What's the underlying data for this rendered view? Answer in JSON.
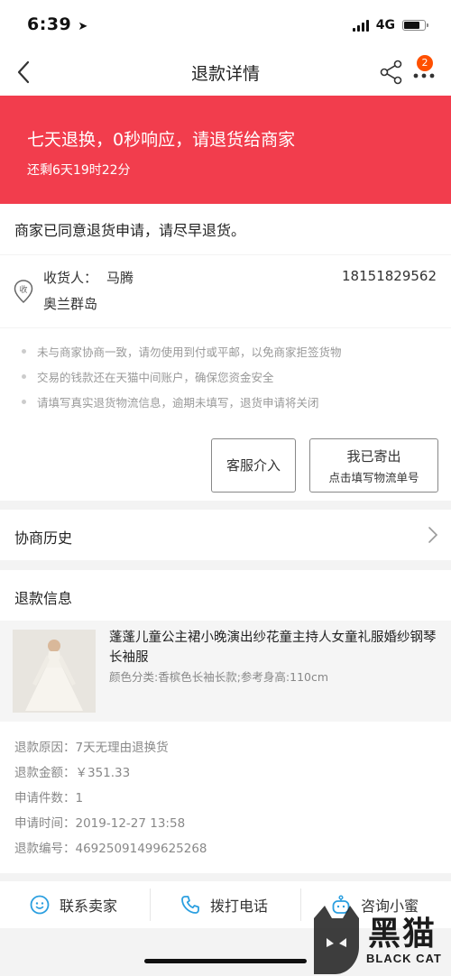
{
  "status_bar": {
    "time": "6:39",
    "network": "4G",
    "battery_level": 0.75
  },
  "nav": {
    "title": "退款详情",
    "badge": "2"
  },
  "banner": {
    "title": "七天退换，0秒响应，请退货给商家",
    "countdown": "还剩6天19时22分",
    "color": "#f23d4d"
  },
  "status_message": "商家已同意退货申请，请尽早退货。",
  "address": {
    "receiver_label": "收货人：",
    "receiver_name": "马腾",
    "phone": "18151829562",
    "address": "奥兰群岛",
    "icon_text": "收"
  },
  "tips": [
    "未与商家协商一致，请勿使用到付或平邮，以免商家拒签货物",
    "交易的钱款还在天猫中间账户，确保您资金安全",
    "请填写真实退货物流信息，逾期未填写，退货申请将关闭"
  ],
  "buttons": {
    "service": "客服介入",
    "sent_line1": "我已寄出",
    "sent_line2": "点击填写物流单号"
  },
  "history_label": "协商历史",
  "refund_section_title": "退款信息",
  "product": {
    "name": "蓬蓬儿童公主裙小晚演出纱花童主持人女童礼服婚纱钢琴长袖服",
    "sku": "颜色分类:香槟色长袖长款;参考身高:110cm"
  },
  "refund_info": [
    {
      "label": "退款原因：",
      "value": "7天无理由退换货"
    },
    {
      "label": "退款金额：",
      "value": "￥351.33"
    },
    {
      "label": "申请件数：",
      "value": "1"
    },
    {
      "label": "申请时间：",
      "value": "2019-12-27 13:58"
    },
    {
      "label": "退款编号：",
      "value": "46925091499625268"
    }
  ],
  "bottom_bar": {
    "contact_seller": "联系卖家",
    "call": "拨打电话",
    "consult": "咨询小蜜"
  },
  "watermark": {
    "cn": "黑猫",
    "en": "BLACK CAT"
  },
  "colors": {
    "accent": "#f23d4d",
    "badge": "#ff5000",
    "icon_blue": "#2b9fe0"
  }
}
